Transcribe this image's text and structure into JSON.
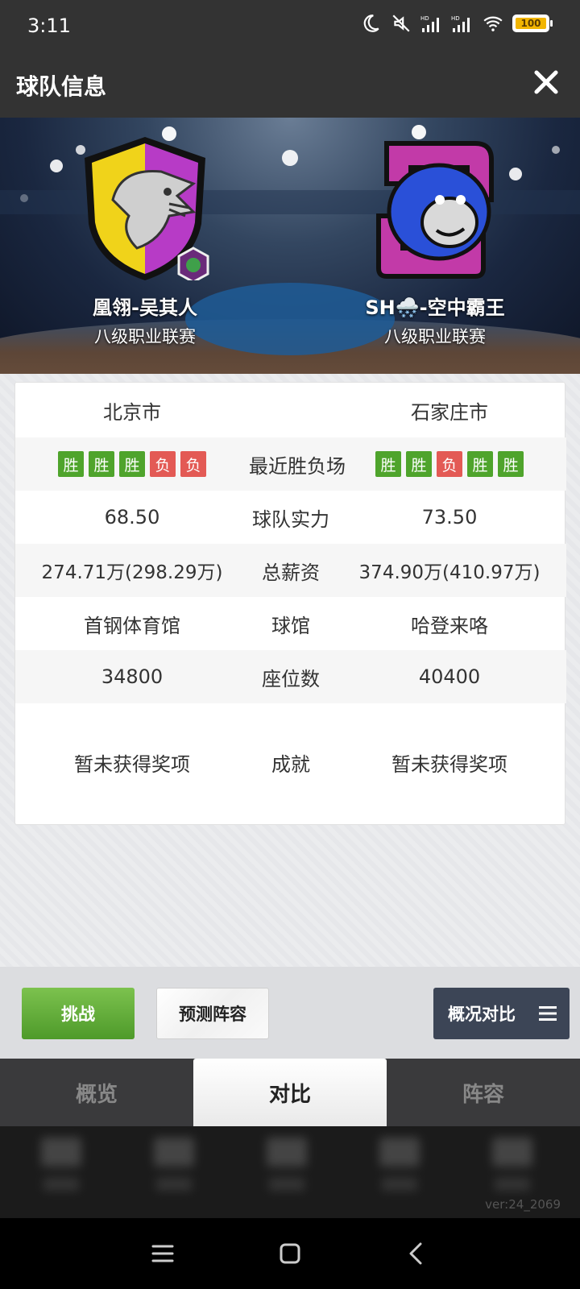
{
  "status_bar": {
    "time": "3:11",
    "battery": "100"
  },
  "header": {
    "title": "球队信息"
  },
  "teams": {
    "home": {
      "name": "凰翎-吴其人",
      "league": "八级职业联赛"
    },
    "away": {
      "name": "SH🌨️-空中霸王",
      "league": "八级职业联赛"
    }
  },
  "comparison": {
    "city": {
      "home": "北京市",
      "away": "石家庄市"
    },
    "recent": {
      "label": "最近胜负场",
      "home": [
        "胜",
        "胜",
        "胜",
        "负",
        "负"
      ],
      "away": [
        "胜",
        "胜",
        "负",
        "胜",
        "胜"
      ]
    },
    "strength": {
      "label": "球队实力",
      "home": "68.50",
      "away": "73.50"
    },
    "salary": {
      "label": "总薪资",
      "home": "274.71万(298.29万)",
      "away": "374.90万(410.97万)"
    },
    "arena": {
      "label": "球馆",
      "home": "首钢体育馆",
      "away": "哈登来咯"
    },
    "seats": {
      "label": "座位数",
      "home": "34800",
      "away": "40400"
    },
    "achievements": {
      "label": "成就",
      "home": "暂未获得奖项",
      "away": "暂未获得奖项"
    }
  },
  "actions": {
    "challenge": "挑战",
    "predict_lineup": "预测阵容",
    "compare_overview": "概况对比"
  },
  "tabs": [
    {
      "label": "概览",
      "active": false
    },
    {
      "label": "对比",
      "active": true
    },
    {
      "label": "阵容",
      "active": false
    }
  ],
  "version": "ver:24_2069",
  "colors": {
    "win": "#4fa42c",
    "loss": "#e35a55",
    "challenge": "#5aa833",
    "compare": "#3c4556"
  }
}
